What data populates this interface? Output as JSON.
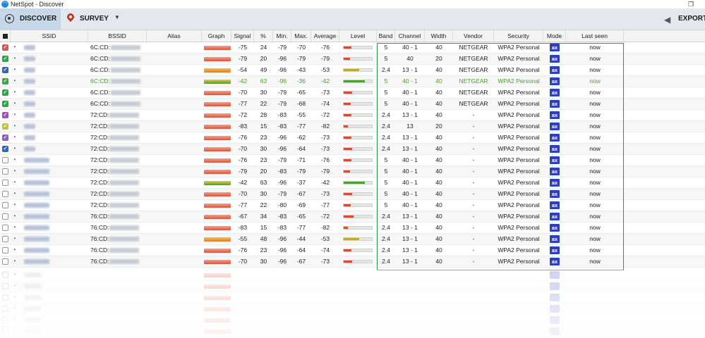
{
  "window": {
    "title": "NetSpot - Discover",
    "restore_glyph": "❐"
  },
  "toolbar": {
    "discover_label": "DISCOVER",
    "survey_label": "SURVEY",
    "export_label": "EXPORT"
  },
  "columns": {
    "ssid": "SSID",
    "bssid": "BSSID",
    "alias": "Alias",
    "graph": "Graph",
    "signal": "Signal",
    "pct": "%",
    "min": "Min.",
    "max": "Max.",
    "avg": "Average",
    "level": "Level",
    "band": "Band",
    "channel": "Channel",
    "width": "Width",
    "vendor": "Vendor",
    "security": "Security",
    "mode": "Mode",
    "last_seen": "Last seen"
  },
  "mode_label": "ax",
  "colors": {
    "checkbox_palette": [
      "#d9534f",
      "#27a844",
      "#2d6bb8",
      "#3fa14a",
      "#27a844",
      "#27a844",
      "#a64ac9",
      "#c4c43a",
      "#8e5cc9",
      "#2d6bb8"
    ]
  },
  "rows": [
    {
      "checked": true,
      "ssid_w": 16,
      "bssid": "6C:CD:",
      "signal": "-75",
      "pct": "24",
      "min": "-79",
      "max": "-70",
      "avg": "-76",
      "band": "5",
      "channel": "40 - 1",
      "width": "40",
      "vendor": "NETGEAR",
      "security": "WPA2 Personal",
      "last": "now",
      "lvl": 0.28,
      "lvlcolor": "#e04a2a"
    },
    {
      "checked": true,
      "ssid_w": 16,
      "bssid": "6C:CD:",
      "signal": "-79",
      "pct": "20",
      "min": "-96",
      "max": "-79",
      "avg": "-79",
      "band": "5",
      "channel": "40",
      "width": "20",
      "vendor": "NETGEAR",
      "security": "WPA2 Personal",
      "last": "now",
      "lvl": 0.22,
      "lvlcolor": "#e04a2a"
    },
    {
      "checked": true,
      "ssid_w": 16,
      "bssid": "6C:CD:",
      "signal": "-54",
      "pct": "49",
      "min": "-96",
      "max": "-43",
      "avg": "-53",
      "band": "2.4",
      "channel": "13 - 1",
      "width": "40",
      "vendor": "NETGEAR",
      "security": "WPA2 Personal",
      "last": "now",
      "lvl": 0.55,
      "lvlcolor": "#c8a82a"
    },
    {
      "checked": true,
      "ssid_w": 16,
      "bssid": "6C:CD:",
      "signal": "-42",
      "pct": "63",
      "min": "-96",
      "max": "-36",
      "avg": "-42",
      "band": "5",
      "channel": "40 - 1",
      "width": "40",
      "vendor": "NETGEAR",
      "security": "WPA2 Personal",
      "last": "now",
      "lvl": 0.75,
      "lvlcolor": "#4aa02c",
      "green": true
    },
    {
      "checked": true,
      "ssid_w": 16,
      "bssid": "6C:CD:",
      "signal": "-70",
      "pct": "30",
      "min": "-79",
      "max": "-65",
      "avg": "-73",
      "band": "5",
      "channel": "40 - 1",
      "width": "40",
      "vendor": "NETGEAR",
      "security": "WPA2 Personal",
      "last": "now",
      "lvl": 0.3,
      "lvlcolor": "#e04a2a"
    },
    {
      "checked": true,
      "ssid_w": 16,
      "bssid": "6C:CD:",
      "signal": "-77",
      "pct": "22",
      "min": "-79",
      "max": "-68",
      "avg": "-74",
      "band": "5",
      "channel": "40 - 1",
      "width": "40",
      "vendor": "NETGEAR",
      "security": "WPA2 Personal",
      "last": "now",
      "lvl": 0.26,
      "lvlcolor": "#e04a2a"
    },
    {
      "checked": true,
      "ssid_w": 16,
      "bssid": "72:CD:",
      "signal": "-72",
      "pct": "28",
      "min": "-83",
      "max": "-55",
      "avg": "-72",
      "band": "2.4",
      "channel": "13 - 1",
      "width": "40",
      "vendor": "-",
      "security": "WPA2 Personal",
      "last": "now",
      "lvl": 0.28,
      "lvlcolor": "#e04a2a"
    },
    {
      "checked": true,
      "ssid_w": 16,
      "bssid": "72:CD:",
      "signal": "-83",
      "pct": "15",
      "min": "-83",
      "max": "-77",
      "avg": "-82",
      "band": "2.4",
      "channel": "13",
      "width": "20",
      "vendor": "-",
      "security": "WPA2 Personal",
      "last": "now",
      "lvl": 0.16,
      "lvlcolor": "#e04a2a"
    },
    {
      "checked": true,
      "ssid_w": 16,
      "bssid": "72:CD:",
      "signal": "-76",
      "pct": "23",
      "min": "-96",
      "max": "-62",
      "avg": "-73",
      "band": "2.4",
      "channel": "13 - 1",
      "width": "40",
      "vendor": "-",
      "security": "WPA2 Personal",
      "last": "now",
      "lvl": 0.28,
      "lvlcolor": "#e04a2a"
    },
    {
      "checked": true,
      "ssid_w": 16,
      "bssid": "72:CD:",
      "signal": "-70",
      "pct": "30",
      "min": "-96",
      "max": "-64",
      "avg": "-73",
      "band": "2.4",
      "channel": "13 - 1",
      "width": "40",
      "vendor": "-",
      "security": "WPA2 Personal",
      "last": "now",
      "lvl": 0.3,
      "lvlcolor": "#e04a2a"
    },
    {
      "checked": false,
      "ssid_w": 36,
      "bssid": "72:CD:",
      "signal": "-76",
      "pct": "23",
      "min": "-79",
      "max": "-71",
      "avg": "-76",
      "band": "5",
      "channel": "40 - 1",
      "width": "40",
      "vendor": "-",
      "security": "WPA2 Personal",
      "last": "now",
      "lvl": 0.28,
      "lvlcolor": "#e04a2a"
    },
    {
      "checked": false,
      "ssid_w": 36,
      "bssid": "72:CD:",
      "signal": "-79",
      "pct": "20",
      "min": "-83",
      "max": "-79",
      "avg": "-79",
      "band": "5",
      "channel": "40 - 1",
      "width": "40",
      "vendor": "-",
      "security": "WPA2 Personal",
      "last": "now",
      "lvl": 0.22,
      "lvlcolor": "#e04a2a"
    },
    {
      "checked": false,
      "ssid_w": 36,
      "bssid": "72:CD:",
      "signal": "-42",
      "pct": "63",
      "min": "-96",
      "max": "-37",
      "avg": "-42",
      "band": "5",
      "channel": "40 - 1",
      "width": "40",
      "vendor": "-",
      "security": "WPA2 Personal",
      "last": "now",
      "lvl": 0.75,
      "lvlcolor": "#4aa02c"
    },
    {
      "checked": false,
      "ssid_w": 36,
      "bssid": "72:CD:",
      "signal": "-70",
      "pct": "30",
      "min": "-79",
      "max": "-67",
      "avg": "-73",
      "band": "5",
      "channel": "40 - 1",
      "width": "40",
      "vendor": "-",
      "security": "WPA2 Personal",
      "last": "now",
      "lvl": 0.3,
      "lvlcolor": "#e04a2a"
    },
    {
      "checked": false,
      "ssid_w": 36,
      "bssid": "72:CD:",
      "signal": "-77",
      "pct": "22",
      "min": "-80",
      "max": "-69",
      "avg": "-77",
      "band": "5",
      "channel": "40 - 1",
      "width": "40",
      "vendor": "-",
      "security": "WPA2 Personal",
      "last": "now",
      "lvl": 0.26,
      "lvlcolor": "#e04a2a"
    },
    {
      "checked": false,
      "ssid_w": 36,
      "bssid": "76:CD:",
      "signal": "-67",
      "pct": "34",
      "min": "-83",
      "max": "-65",
      "avg": "-72",
      "band": "2.4",
      "channel": "13 - 1",
      "width": "40",
      "vendor": "-",
      "security": "WPA2 Personal",
      "last": "now",
      "lvl": 0.34,
      "lvlcolor": "#e04a2a"
    },
    {
      "checked": false,
      "ssid_w": 36,
      "bssid": "76:CD:",
      "signal": "-83",
      "pct": "15",
      "min": "-83",
      "max": "-77",
      "avg": "-82",
      "band": "2.4",
      "channel": "13 - 1",
      "width": "40",
      "vendor": "-",
      "security": "WPA2 Personal",
      "last": "now",
      "lvl": 0.16,
      "lvlcolor": "#e04a2a"
    },
    {
      "checked": false,
      "ssid_w": 36,
      "bssid": "76:CD:",
      "signal": "-55",
      "pct": "48",
      "min": "-96",
      "max": "-44",
      "avg": "-53",
      "band": "2.4",
      "channel": "13 - 1",
      "width": "40",
      "vendor": "-",
      "security": "WPA2 Personal",
      "last": "now",
      "lvl": 0.55,
      "lvlcolor": "#c8a82a"
    },
    {
      "checked": false,
      "ssid_w": 36,
      "bssid": "76:CD:",
      "signal": "-76",
      "pct": "23",
      "min": "-96",
      "max": "-64",
      "avg": "-74",
      "band": "2.4",
      "channel": "13 - 1",
      "width": "40",
      "vendor": "-",
      "security": "WPA2 Personal",
      "last": "now",
      "lvl": 0.28,
      "lvlcolor": "#e04a2a"
    },
    {
      "checked": false,
      "ssid_w": 36,
      "bssid": "76:CD:",
      "signal": "-70",
      "pct": "30",
      "min": "-96",
      "max": "-67",
      "avg": "-73",
      "band": "2.4",
      "channel": "13 - 1",
      "width": "40",
      "vendor": "-",
      "security": "WPA2 Personal",
      "last": "now",
      "lvl": 0.3,
      "lvlcolor": "#e04a2a"
    }
  ]
}
